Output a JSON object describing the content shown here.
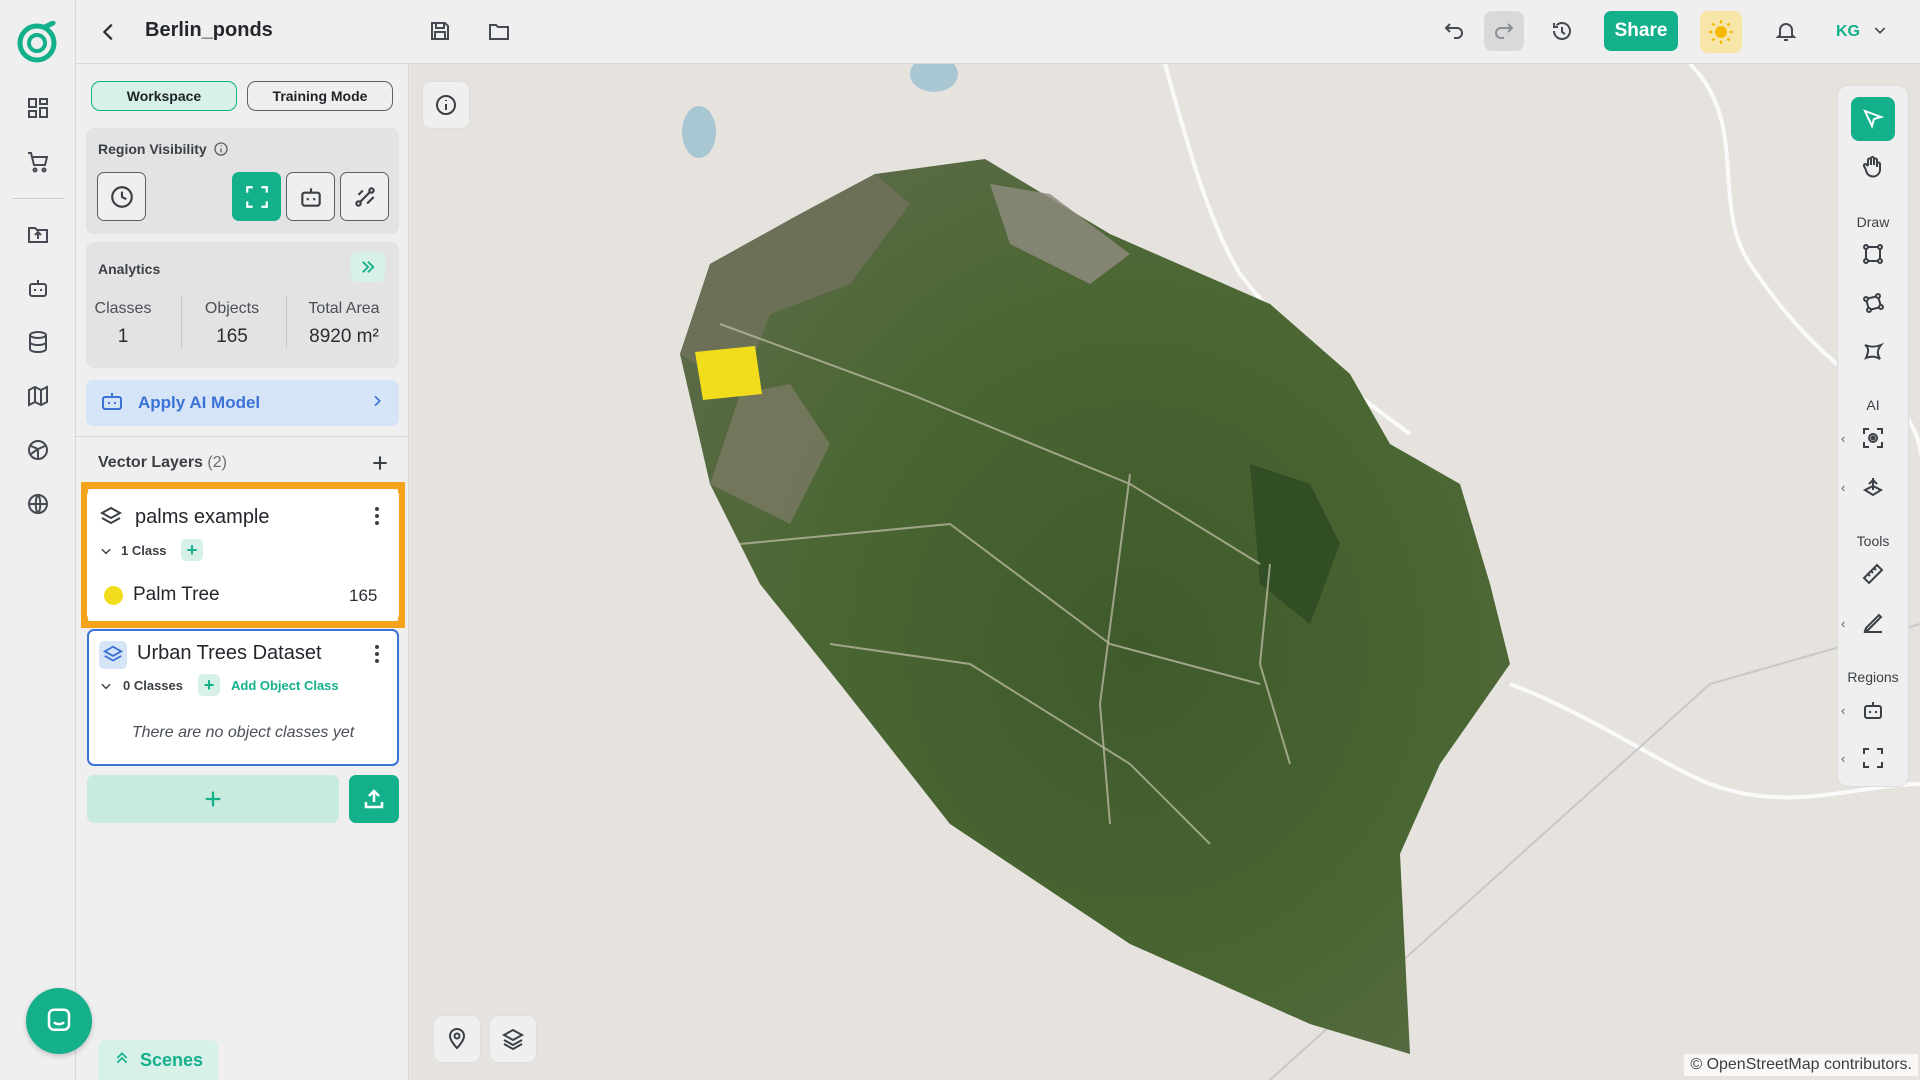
{
  "app": {
    "project_title": "Berlin_ponds"
  },
  "topbar": {
    "share_label": "Share",
    "user_initials": "KG"
  },
  "panel": {
    "tabs": [
      {
        "label": "Workspace",
        "active": true
      },
      {
        "label": "Training Mode",
        "active": false
      }
    ],
    "region_visibility": {
      "label": "Region Visibility"
    },
    "analytics": {
      "label": "Analytics",
      "stats": [
        {
          "label": "Classes",
          "value": "1"
        },
        {
          "label": "Objects",
          "value": "165"
        },
        {
          "label": "Total Area",
          "value": "8920 m²"
        }
      ]
    },
    "apply_ai_model": "Apply AI Model",
    "vector_layers": {
      "title": "Vector Layers",
      "count": "(2)",
      "layers": [
        {
          "name": "palms example",
          "class_count": "1 Class",
          "classes": [
            {
              "name": "Palm Tree",
              "count": "165",
              "color": "#f2dd1c"
            }
          ]
        },
        {
          "name": "Urban Trees Dataset",
          "class_count": "0 Classes",
          "add_class_label": "Add Object Class",
          "empty_text": "There are no object classes yet"
        }
      ]
    }
  },
  "toolbar": {
    "sections": {
      "draw": "Draw",
      "ai": "AI",
      "tools": "Tools",
      "regions": "Regions"
    }
  },
  "map": {
    "attribution": "© OpenStreetMap contributors."
  },
  "bottom": {
    "scenes_label": "Scenes"
  },
  "colors": {
    "accent": "#14b08c",
    "highlight": "#f5a31a",
    "blue": "#3a72d6",
    "palm_marker": "#f2dd1c"
  }
}
